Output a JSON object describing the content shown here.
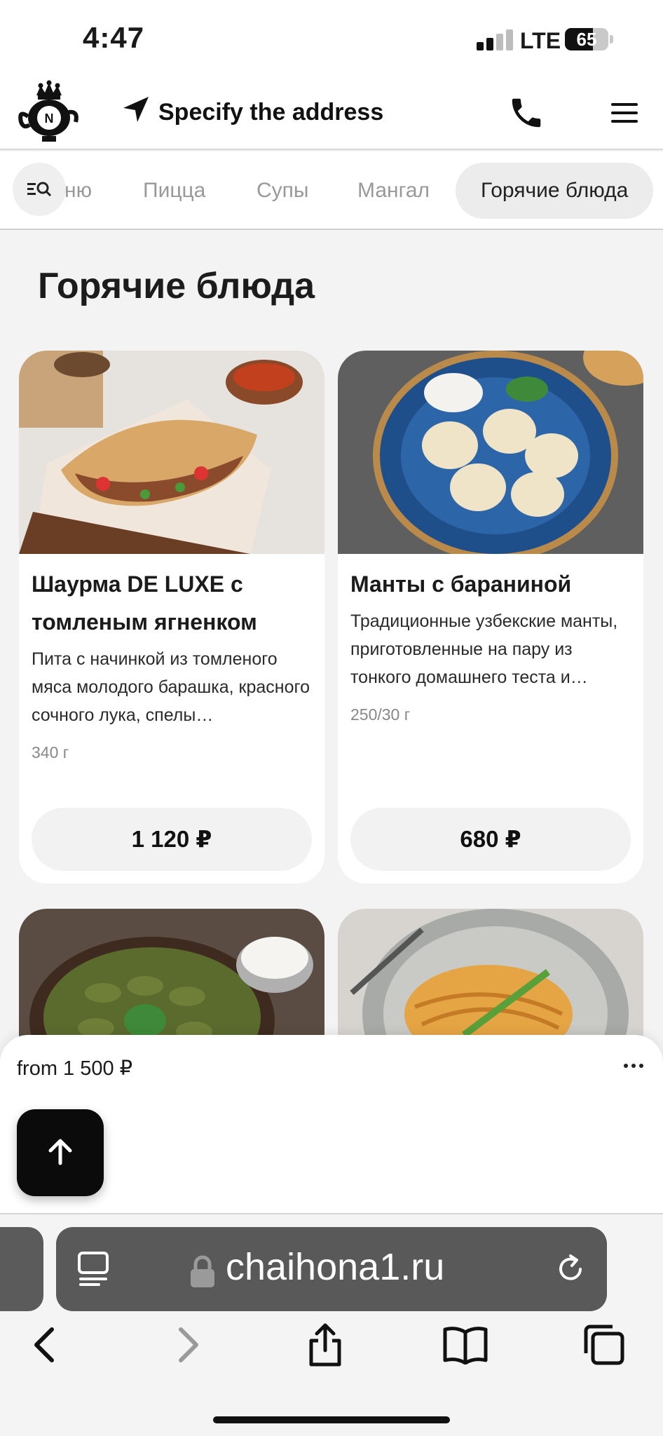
{
  "status_bar": {
    "time": "4:47",
    "network": "LTE",
    "battery": "65",
    "battery_level": 0.65
  },
  "header": {
    "logo_icon": "chaihona-logo-icon",
    "address_label": "Specify the address",
    "phone_icon": "phone-icon",
    "menu_icon": "hamburger-menu-icon"
  },
  "tabs": {
    "search_icon": "menu-search-icon",
    "items": [
      {
        "label": "ню",
        "active": false
      },
      {
        "label": "Пицца",
        "active": false
      },
      {
        "label": "Супы",
        "active": false
      },
      {
        "label": "Мангал",
        "active": false
      },
      {
        "label": "Горячие блюда",
        "active": true
      }
    ]
  },
  "section": {
    "title": "Горячие блюда"
  },
  "products": [
    {
      "title": "Шаурма DE LUXE с томленым ягненком",
      "description": "Пита с начинкой из томленого мяса молодого барашка, красного сочного лука, спелы…",
      "weight": "340 г",
      "price": "1 120 ₽"
    },
    {
      "title": "Манты с бараниной",
      "description": "Традиционные узбекские манты, приготовленные на пару из тонкого домашнего теста и…",
      "weight": "250/30 г",
      "price": "680 ₽"
    }
  ],
  "cart": {
    "from_label": "from 1 500 ₽",
    "more_icon": "more-dots-icon",
    "scroll_top_icon": "arrow-up-icon"
  },
  "browser": {
    "url": "chaihona1.ru",
    "reader_icon": "reader-mode-icon",
    "lock_icon": "lock-icon",
    "reload_icon": "reload-icon",
    "nav": [
      "back-icon",
      "forward-icon",
      "share-icon",
      "bookmarks-icon",
      "tabs-icon"
    ]
  },
  "colors": {
    "accent": "#111111",
    "background": "#f3f3f3",
    "card": "#ffffff",
    "url_bar": "#595959"
  }
}
